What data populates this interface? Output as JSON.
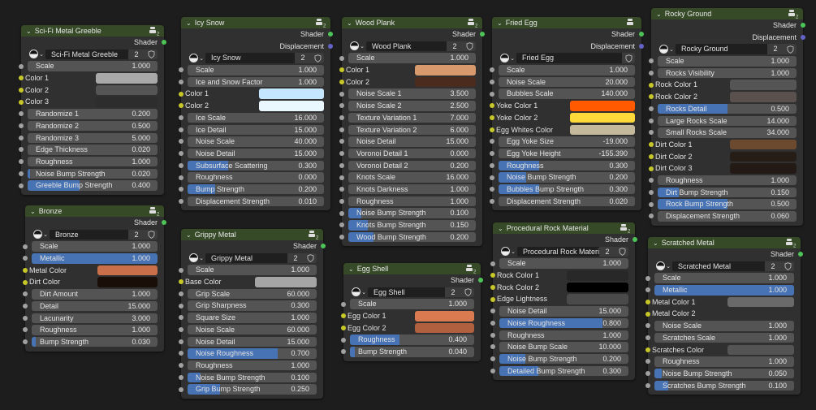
{
  "colors": {
    "shader_socket": "#4dc457",
    "displacement_socket": "#6363c7",
    "value_socket": "#a1a1a1",
    "color_socket": "#c7c729",
    "factor_fill": "#4772b3",
    "header": "#364a27"
  },
  "nodes": [
    {
      "title": "Sci-Fi Metal Greeble",
      "group_users": "2",
      "outputs": [
        "Shader"
      ],
      "material": {
        "name": "Sci-Fi Metal Greeble",
        "users": "2"
      },
      "inputs": [
        {
          "label": "Scale",
          "value": "1.000"
        },
        {
          "label": "Color 1",
          "color": "#a9a9a9"
        },
        {
          "label": "Color 2",
          "color": "#555555"
        },
        {
          "label": "Color 3",
          "color": "#2d2d2d"
        },
        {
          "label": "Randomize 1",
          "value": "0.200"
        },
        {
          "label": "Randomize 2",
          "value": "0.500"
        },
        {
          "label": "Randomize 3",
          "value": "5.000"
        },
        {
          "label": "Edge Thickness",
          "value": "0.020"
        },
        {
          "label": "Roughness",
          "value": "1.000"
        },
        {
          "label": "Noise Bump Strength",
          "value": "0.020",
          "factor": 0.02
        },
        {
          "label": "Greeble Bump Strength",
          "value": "0.400",
          "factor": 0.4
        }
      ]
    },
    {
      "title": "Bronze",
      "group_users": "2",
      "outputs": [
        "Shader"
      ],
      "material": {
        "name": "Bronze",
        "users": "2"
      },
      "inputs": [
        {
          "label": "Scale",
          "value": "1.000"
        },
        {
          "label": "Metallic",
          "value": "1.000",
          "factor": 1.0
        },
        {
          "label": "Metal Color",
          "color": "#c9704a"
        },
        {
          "label": "Dirt Color",
          "color": "#1a0e08"
        },
        {
          "label": "Dirt Amount",
          "value": "1.000"
        },
        {
          "label": "Detail",
          "value": "15.000"
        },
        {
          "label": "Lacunarity",
          "value": "3.000"
        },
        {
          "label": "Roughness",
          "value": "1.000"
        },
        {
          "label": "Bump Strength",
          "value": "0.030",
          "factor": 0.03
        }
      ]
    },
    {
      "title": "Icy Snow",
      "group_users": "2",
      "outputs": [
        "Shader",
        "Displacement"
      ],
      "material": {
        "name": "Icy Snow",
        "users": "2"
      },
      "inputs": [
        {
          "label": "Scale",
          "value": "1.000"
        },
        {
          "label": "Ice and Snow Factor",
          "value": "1.000"
        },
        {
          "label": "Color 1",
          "color": "#c5e6ff"
        },
        {
          "label": "Color 2",
          "color": "#e9f7ff"
        },
        {
          "label": "Ice Scale",
          "value": "16.000"
        },
        {
          "label": "Ice Detail",
          "value": "15.000"
        },
        {
          "label": "Noise Scale",
          "value": "40.000"
        },
        {
          "label": "Noise Detail",
          "value": "15.000"
        },
        {
          "label": "Subsurface Scattering",
          "value": "0.300",
          "factor": 0.3
        },
        {
          "label": "Roughness",
          "value": "0.000",
          "factor": 0.0
        },
        {
          "label": "Bump Strength",
          "value": "0.200",
          "factor": 0.2
        },
        {
          "label": "Displacement Strength",
          "value": "0.010"
        }
      ]
    },
    {
      "title": "Grippy Metal",
      "group_users": "2",
      "outputs": [
        "Shader"
      ],
      "material": {
        "name": "Grippy Metal",
        "users": "2"
      },
      "inputs": [
        {
          "label": "Scale",
          "value": "1.000"
        },
        {
          "label": "Base Color",
          "color": "#a5a5a5"
        },
        {
          "label": "Grip Scale",
          "value": "60.000"
        },
        {
          "label": "Grip Sharpness",
          "value": "0.300"
        },
        {
          "label": "Square Size",
          "value": "1.000"
        },
        {
          "label": "Noise Scale",
          "value": "60.000"
        },
        {
          "label": "Noise Detail",
          "value": "15.000"
        },
        {
          "label": "Noise Roughness",
          "value": "0.700",
          "factor": 0.7
        },
        {
          "label": "Roughness",
          "value": "1.000"
        },
        {
          "label": "Noise Bump Strength",
          "value": "0.100",
          "factor": 0.1
        },
        {
          "label": "Grip Bump Strength",
          "value": "0.250",
          "factor": 0.25
        }
      ]
    },
    {
      "title": "Wood Plank",
      "group_users": "2",
      "outputs": [
        "Shader"
      ],
      "material": {
        "name": "Wood Plank",
        "users": "2"
      },
      "inputs": [
        {
          "label": "Scale",
          "value": "1.000"
        },
        {
          "label": "Color 1",
          "color": "#d89a6d"
        },
        {
          "label": "Color 2",
          "color": "#4b2b1d"
        },
        {
          "label": "Noise Scale 1",
          "value": "3.500"
        },
        {
          "label": "Noise Scale 2",
          "value": "2.500"
        },
        {
          "label": "Texture Variation 1",
          "value": "7.000"
        },
        {
          "label": "Texture Variation 2",
          "value": "6.000"
        },
        {
          "label": "Noise Detail",
          "value": "15.000"
        },
        {
          "label": "Voronoi Detail 1",
          "value": "0.000"
        },
        {
          "label": "Voronoi Detail 2",
          "value": "0.200"
        },
        {
          "label": "Knots Scale",
          "value": "16.000"
        },
        {
          "label": "Knots Darkness",
          "value": "1.000"
        },
        {
          "label": "Roughness",
          "value": "1.000"
        },
        {
          "label": "Noise Bump Strength",
          "value": "0.100",
          "factor": 0.1
        },
        {
          "label": "Knots Bump Strength",
          "value": "0.150",
          "factor": 0.15
        },
        {
          "label": "Wood Bump Strength",
          "value": "0.200",
          "factor": 0.2
        }
      ]
    },
    {
      "title": "Egg Shell",
      "group_users": "2",
      "outputs": [
        "Shader"
      ],
      "material": {
        "name": "Egg Shell",
        "users": "2"
      },
      "inputs": [
        {
          "label": "Scale",
          "value": "1.000"
        },
        {
          "label": "Egg Color 1",
          "color": "#d97a50"
        },
        {
          "label": "Egg Color 2",
          "color": "#b0603f"
        },
        {
          "label": "Roughness",
          "value": "0.400",
          "factor": 0.4
        },
        {
          "label": "Bump Strength",
          "value": "0.040",
          "factor": 0.04
        }
      ]
    },
    {
      "title": "Fried Egg",
      "group_users": "",
      "outputs": [
        "Shader",
        "Displacement"
      ],
      "material": {
        "name": "Fried Egg",
        "users": ""
      },
      "inputs": [
        {
          "label": "Scale",
          "value": "1.000"
        },
        {
          "label": "Noise Scale",
          "value": "20.000"
        },
        {
          "label": "Bubbles Scale",
          "value": "140.000"
        },
        {
          "label": "Yoke Color 1",
          "color": "#ff5a00"
        },
        {
          "label": "Yoke Color 2",
          "color": "#ffd83a"
        },
        {
          "label": "Egg Whites Color",
          "color": "#c5b99b"
        },
        {
          "label": "Egg Yoke Size",
          "value": "-19.000"
        },
        {
          "label": "Egg Yoke Height",
          "value": "-155.390"
        },
        {
          "label": "Roughness",
          "value": "0.300",
          "factor": 0.3
        },
        {
          "label": "Noise Bump Strength",
          "value": "0.200",
          "factor": 0.2
        },
        {
          "label": "Bubbles Bump Strength",
          "value": "0.300",
          "factor": 0.3
        },
        {
          "label": "Displacement Strength",
          "value": "0.020"
        }
      ]
    },
    {
      "title": "Procedural Rock Material",
      "group_users": "2",
      "outputs": [
        "Shader"
      ],
      "material": {
        "name": "Procedural Rock Material",
        "users": "2"
      },
      "inputs": [
        {
          "label": "Scale",
          "value": "1.000"
        },
        {
          "label": "Rock Color 1",
          "color": "#282828"
        },
        {
          "label": "Rock Color 2",
          "color": "#000000"
        },
        {
          "label": "Edge Lightness",
          "color": "#4a4a4a"
        },
        {
          "label": "Noise Detail",
          "value": "15.000"
        },
        {
          "label": "Noise Roughness",
          "value": "0.800",
          "factor": 0.8
        },
        {
          "label": "Roughness",
          "value": "1.000"
        },
        {
          "label": "Noise Bump Scale",
          "value": "10.000"
        },
        {
          "label": "Noise Bump Strength",
          "value": "0.200",
          "factor": 0.2
        },
        {
          "label": "Detailed Bump Strength",
          "value": "0.300",
          "factor": 0.3
        }
      ]
    },
    {
      "title": "Rocky Ground",
      "group_users": "2",
      "outputs": [
        "Shader",
        "Displacement"
      ],
      "material": {
        "name": "Rocky Ground",
        "users": "2"
      },
      "inputs": [
        {
          "label": "Scale",
          "value": "1.000"
        },
        {
          "label": "Rocks Visibility",
          "value": "1.000"
        },
        {
          "label": "Rock Color 1",
          "color": "#555555"
        },
        {
          "label": "Rock Color 2",
          "color": "#5a504e"
        },
        {
          "label": "Rocks Detail",
          "value": "0.500",
          "factor": 0.5
        },
        {
          "label": "Large Rocks Scale",
          "value": "14.000"
        },
        {
          "label": "Small Rocks Scale",
          "value": "34.000"
        },
        {
          "label": "Dirt Color 1",
          "color": "#6b4a30"
        },
        {
          "label": "Dirt Color 2",
          "color": "#261e16"
        },
        {
          "label": "Dirt Color 3",
          "color": "#231a15"
        },
        {
          "label": "Roughness",
          "value": "1.000"
        },
        {
          "label": "Dirt Bump Strength",
          "value": "0.150",
          "factor": 0.15
        },
        {
          "label": "Rock Bump Strength",
          "value": "0.500",
          "factor": 0.5
        },
        {
          "label": "Displacement Strength",
          "value": "0.060"
        }
      ]
    },
    {
      "title": "Scratched Metal",
      "group_users": "2",
      "outputs": [
        "Shader"
      ],
      "material": {
        "name": "Scratched Metal",
        "users": "2"
      },
      "inputs": [
        {
          "label": "Scale",
          "value": "1.000"
        },
        {
          "label": "Metallic",
          "value": "1.000",
          "factor": 1.0
        },
        {
          "label": "Metal Color 1",
          "color": "#6a6a6a"
        },
        {
          "label": "Metal Color 2",
          "color": "#303030"
        },
        {
          "label": "Noise Scale",
          "value": "1.000"
        },
        {
          "label": "Scratches Scale",
          "value": "1.000"
        },
        {
          "label": "Scratches Color",
          "color": "#545454"
        },
        {
          "label": "Roughness",
          "value": "1.000"
        },
        {
          "label": "Noise Bump Strength",
          "value": "0.050",
          "factor": 0.05
        },
        {
          "label": "Scratches Bump Strength",
          "value": "0.100",
          "factor": 0.1
        }
      ]
    }
  ]
}
